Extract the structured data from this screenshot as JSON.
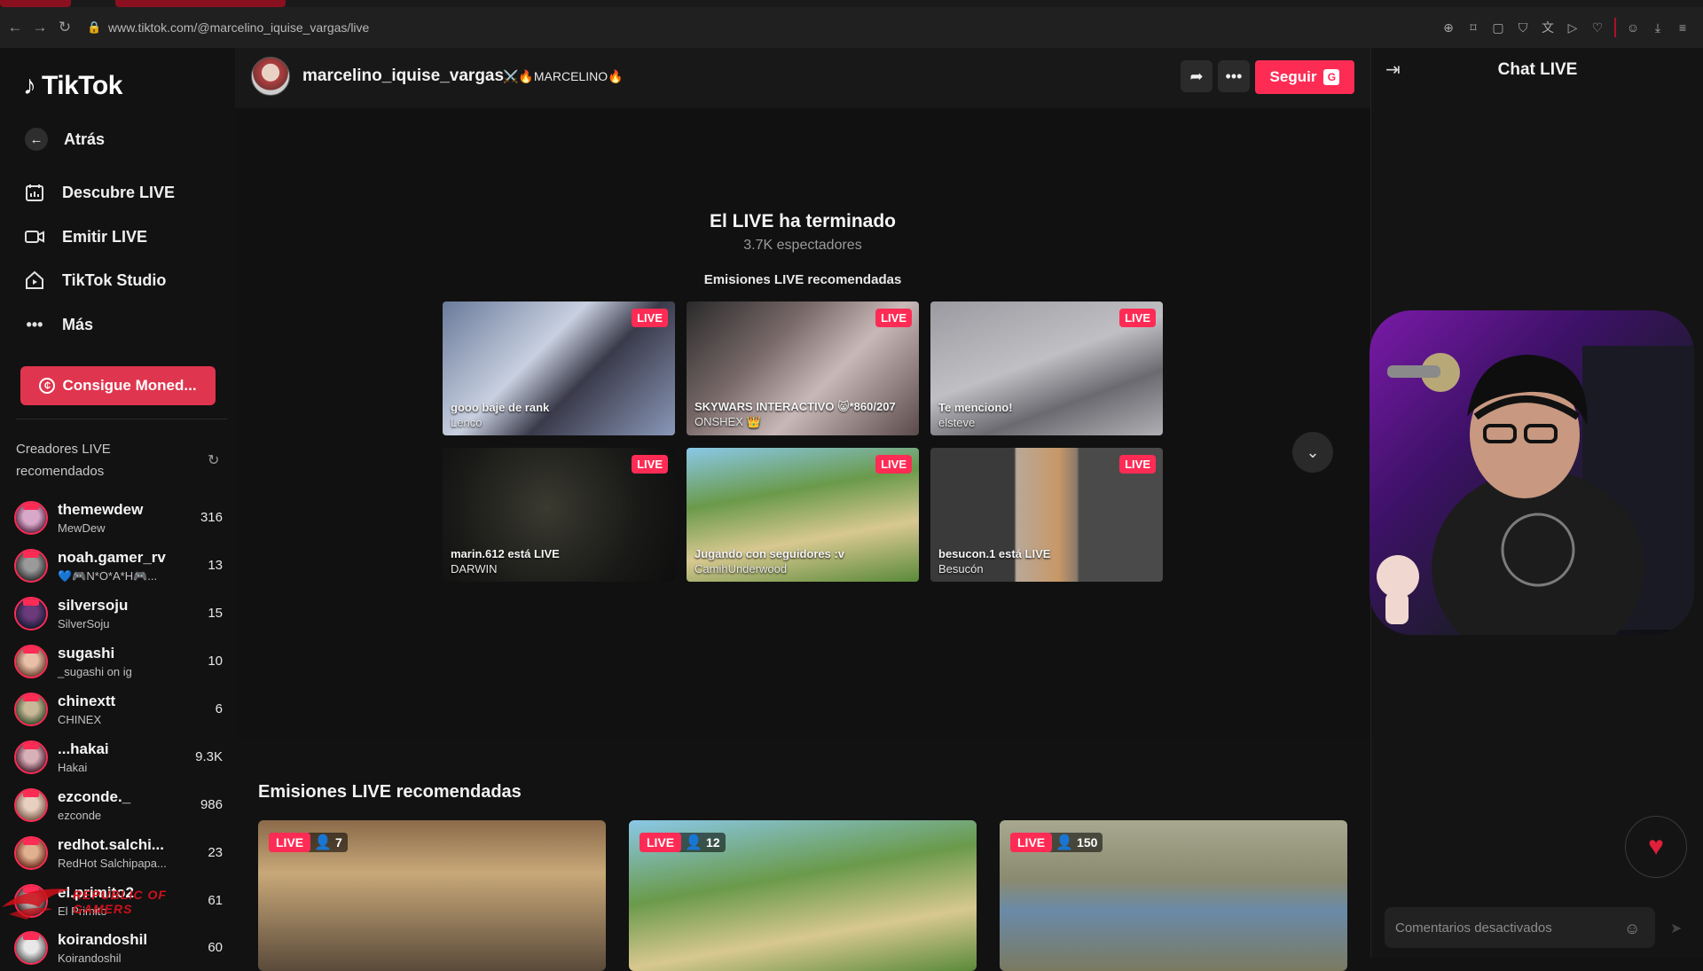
{
  "browser": {
    "url": "www.tiktok.com/@marcelino_iquise_vargas/live",
    "nav_icons": [
      "back-icon",
      "forward-icon",
      "reload-icon",
      "lock-icon"
    ],
    "toolbar_icons": [
      "zoom-icon",
      "bookmark-icon",
      "screenshot-icon",
      "shield-icon",
      "translate-icon",
      "play-icon",
      "heart-icon",
      "profile-icon",
      "download-icon",
      "menu-icon"
    ]
  },
  "sidebar": {
    "logo": "TikTok",
    "nav": [
      {
        "label": "Atrás",
        "icon": "arrow-left-icon"
      },
      {
        "label": "Descubre LIVE",
        "icon": "calendar-live-icon"
      },
      {
        "label": "Emitir LIVE",
        "icon": "video-camera-icon"
      },
      {
        "label": "TikTok Studio",
        "icon": "studio-house-icon"
      },
      {
        "label": "Más",
        "icon": "more-dots-icon"
      }
    ],
    "coins_button": "Consigue Moned...",
    "creators_heading": "Creadores LIVE recomendados",
    "creators": [
      {
        "name": "themewdew",
        "sub": "MewDew",
        "count": "316"
      },
      {
        "name": "noah.gamer_rv",
        "sub": "💙🎮N*O*A*H🎮...",
        "count": "13"
      },
      {
        "name": "silversoju",
        "sub": "SilverSoju",
        "count": "15"
      },
      {
        "name": "sugashi",
        "sub": "_sugashi on ig",
        "count": "10"
      },
      {
        "name": "chinextt",
        "sub": "CHINEX",
        "count": "6"
      },
      {
        "name": "...hakai",
        "sub": "Hakai",
        "count": "9.3K"
      },
      {
        "name": "ezconde._",
        "sub": "ezconde",
        "count": "986"
      },
      {
        "name": "redhot.salchi...",
        "sub": "RedHot Salchipapa...",
        "count": "23"
      },
      {
        "name": "el.primito2",
        "sub": "El Primito",
        "count": "61"
      },
      {
        "name": "koirandoshil",
        "sub": "Koirandoshil",
        "count": "60"
      }
    ],
    "overlay_brand": "REPUBLIC OF GAMERS"
  },
  "header": {
    "username": "marcelino_iquise_vargas",
    "badge": "⚔️🔥MARCELINO🔥",
    "share_icon": "share-arrow-icon",
    "more_icon": "more-dots-icon",
    "follow_label": "Seguir",
    "follow_shortcut": "G"
  },
  "stage": {
    "ended_title": "El LIVE ha terminado",
    "viewers": "3.7K espectadores",
    "recommended_title": "Emisiones LIVE recomendadas",
    "live_label": "LIVE",
    "tiles": [
      {
        "line1": "gooo baje de rank",
        "line2": "Lenco"
      },
      {
        "line1": "SKYWARS INTERACTIVO 😸*860/207",
        "line2": "ONSHEX 👑"
      },
      {
        "line1": "Te menciono!",
        "line2": "elsteve"
      },
      {
        "line1": "marin.612 está LIVE",
        "line2": "DARWIN"
      },
      {
        "line1": "Jugando con seguidores :v",
        "line2": "CamihUnderwood"
      },
      {
        "line1": "besucon.1 está LIVE",
        "line2": "Besucón"
      }
    ],
    "expand_icon": "chevron-down-icon"
  },
  "recommended": {
    "title": "Emisiones LIVE recomendadas",
    "cards": [
      {
        "live": "LIVE",
        "viewers": "7"
      },
      {
        "live": "LIVE",
        "viewers": "12"
      },
      {
        "live": "LIVE",
        "viewers": "150"
      }
    ]
  },
  "chat": {
    "title": "Chat LIVE",
    "collapse_icon": "collapse-right-icon",
    "comment_placeholder": "Comentarios desactivados",
    "emoji_icon": "emoji-icon",
    "send_icon": "send-icon",
    "heart_icon": "heart-icon"
  },
  "colors": {
    "accent": "#fe2c55",
    "coins": "#e0354f",
    "background": "#121212"
  }
}
